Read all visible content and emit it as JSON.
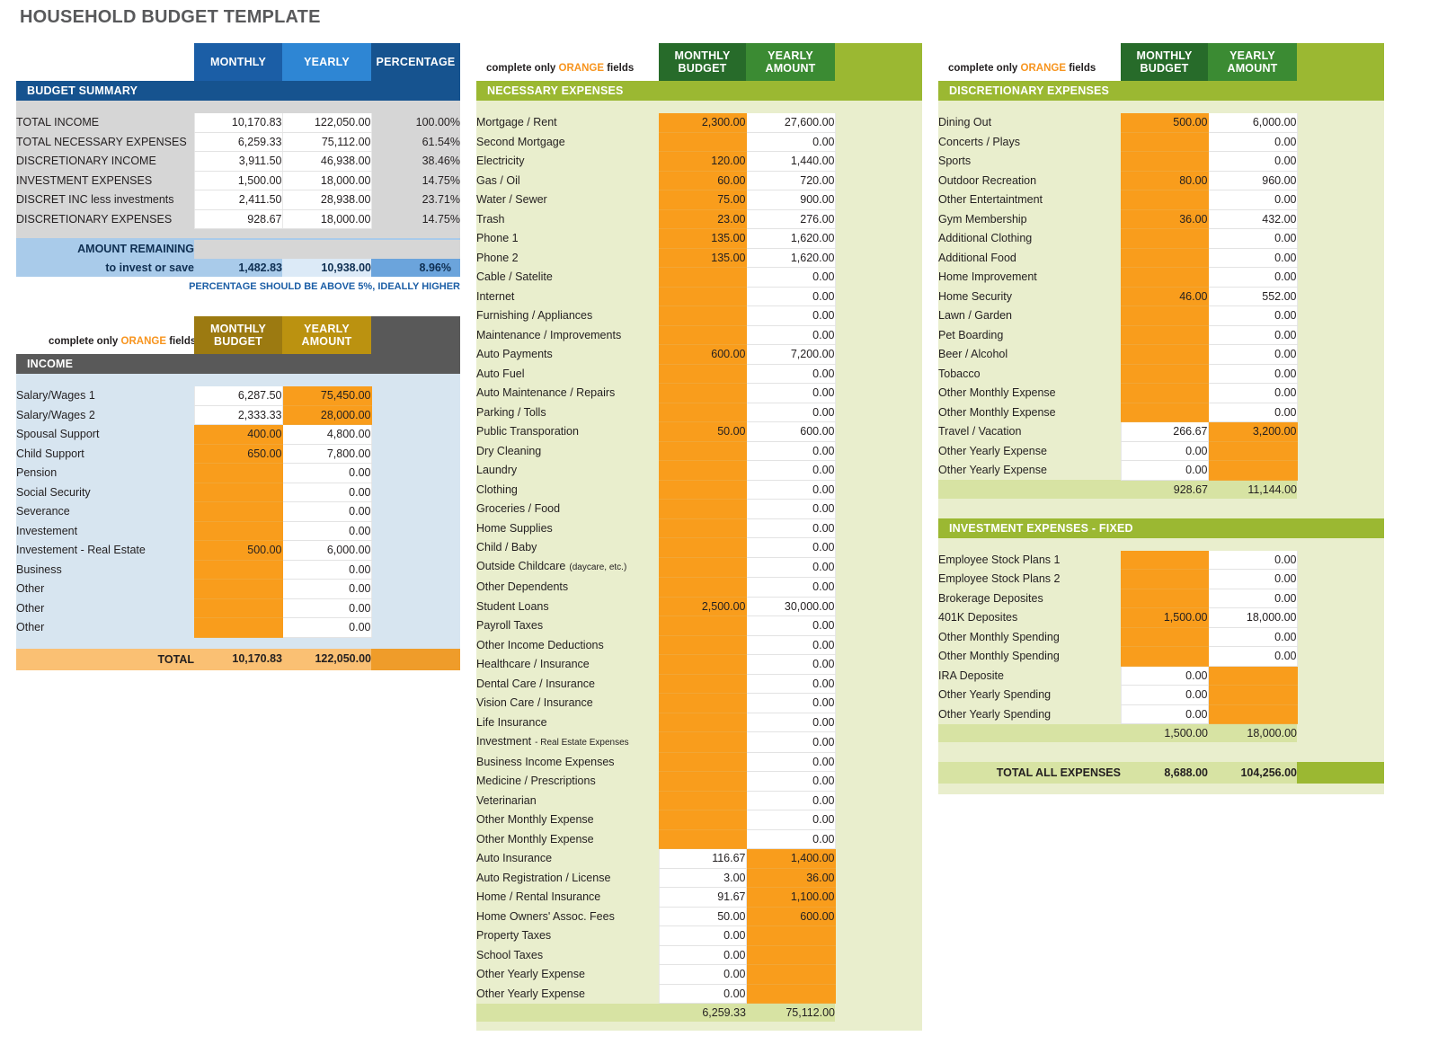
{
  "page_title": "HOUSEHOLD BUDGET TEMPLATE",
  "colors": {
    "orange": "#f99d1c",
    "blue_dark": "#16538f",
    "blue_mid": "#1b5ea6",
    "blue_light": "#2e86d4",
    "green_dark": "#276b2a",
    "green_mid": "#3b8b33",
    "green_light": "#9bb832",
    "gold": "#9c7a11",
    "grey": "#595959"
  },
  "summary": {
    "headers": [
      "MONTHLY",
      "YEARLY",
      "PERCENTAGE"
    ],
    "section_title": "BUDGET SUMMARY",
    "rows": [
      {
        "label": "TOTAL INCOME",
        "monthly": "10,170.83",
        "yearly": "122,050.00",
        "percentage": "100.00%"
      },
      {
        "label": "TOTAL NECESSARY EXPENSES",
        "monthly": "6,259.33",
        "yearly": "75,112.00",
        "percentage": "61.54%"
      },
      {
        "label": "DISCRETIONARY INCOME",
        "monthly": "3,911.50",
        "yearly": "46,938.00",
        "percentage": "38.46%"
      },
      {
        "label": "INVESTMENT EXPENSES",
        "monthly": "1,500.00",
        "yearly": "18,000.00",
        "percentage": "14.75%"
      },
      {
        "label": "DISCRET INC less investments",
        "monthly": "2,411.50",
        "yearly": "28,938.00",
        "percentage": "23.71%"
      },
      {
        "label": "DISCRETIONARY EXPENSES",
        "monthly": "928.67",
        "yearly": "18,000.00",
        "percentage": "14.75%"
      }
    ],
    "remaining": {
      "line1": "AMOUNT REMAINING",
      "line2": "to invest or save",
      "monthly": "1,482.83",
      "yearly": "10,938.00",
      "percentage": "8.96%"
    },
    "note": "PERCENTAGE SHOULD BE ABOVE 5%, IDEALLY HIGHER"
  },
  "complete_only": {
    "pre": "complete only ",
    "orange": "ORANGE",
    "post": " fields"
  },
  "income": {
    "headers": [
      "MONTHLY\nBUDGET",
      "YEARLY\nAMOUNT"
    ],
    "header_monthly_l1": "MONTHLY",
    "header_monthly_l2": "BUDGET",
    "header_yearly_l1": "YEARLY",
    "header_yearly_l2": "AMOUNT",
    "section_title": "INCOME",
    "rows": [
      {
        "label": "Salary/Wages 1",
        "monthly": "6,287.50",
        "yearly": "75,450.00",
        "monthly_orange": false,
        "yearly_orange": true
      },
      {
        "label": "Salary/Wages 2",
        "monthly": "2,333.33",
        "yearly": "28,000.00",
        "monthly_orange": false,
        "yearly_orange": true
      },
      {
        "label": "Spousal Support",
        "monthly": "400.00",
        "yearly": "4,800.00",
        "monthly_orange": true,
        "yearly_orange": false
      },
      {
        "label": "Child Support",
        "monthly": "650.00",
        "yearly": "7,800.00",
        "monthly_orange": true,
        "yearly_orange": false
      },
      {
        "label": "Pension",
        "monthly": "",
        "yearly": "0.00",
        "monthly_orange": true,
        "yearly_orange": false
      },
      {
        "label": "Social Security",
        "monthly": "",
        "yearly": "0.00",
        "monthly_orange": true,
        "yearly_orange": false
      },
      {
        "label": "Severance",
        "monthly": "",
        "yearly": "0.00",
        "monthly_orange": true,
        "yearly_orange": false
      },
      {
        "label": "Investement",
        "monthly": "",
        "yearly": "0.00",
        "monthly_orange": true,
        "yearly_orange": false
      },
      {
        "label": "Investement - Real Estate",
        "monthly": "500.00",
        "yearly": "6,000.00",
        "monthly_orange": true,
        "yearly_orange": false
      },
      {
        "label": "Business",
        "monthly": "",
        "yearly": "0.00",
        "monthly_orange": true,
        "yearly_orange": false
      },
      {
        "label": "Other",
        "monthly": "",
        "yearly": "0.00",
        "monthly_orange": true,
        "yearly_orange": false
      },
      {
        "label": "Other",
        "monthly": "",
        "yearly": "0.00",
        "monthly_orange": true,
        "yearly_orange": false
      },
      {
        "label": "Other",
        "monthly": "",
        "yearly": "0.00",
        "monthly_orange": true,
        "yearly_orange": false
      }
    ],
    "total": {
      "label": "TOTAL",
      "monthly": "10,170.83",
      "yearly": "122,050.00"
    }
  },
  "necessary": {
    "header_monthly_l1": "MONTHLY",
    "header_monthly_l2": "BUDGET",
    "header_yearly_l1": "YEARLY",
    "header_yearly_l2": "AMOUNT",
    "section_title": "NECESSARY EXPENSES",
    "rows": [
      {
        "label": "Mortgage / Rent",
        "monthly": "2,300.00",
        "yearly": "27,600.00",
        "monthly_orange": true,
        "yearly_orange": false
      },
      {
        "label": "Second Mortgage",
        "monthly": "",
        "yearly": "0.00",
        "monthly_orange": true,
        "yearly_orange": false
      },
      {
        "label": "Electricity",
        "monthly": "120.00",
        "yearly": "1,440.00",
        "monthly_orange": true,
        "yearly_orange": false
      },
      {
        "label": "Gas / Oil",
        "monthly": "60.00",
        "yearly": "720.00",
        "monthly_orange": true,
        "yearly_orange": false
      },
      {
        "label": "Water / Sewer",
        "monthly": "75.00",
        "yearly": "900.00",
        "monthly_orange": true,
        "yearly_orange": false
      },
      {
        "label": "Trash",
        "monthly": "23.00",
        "yearly": "276.00",
        "monthly_orange": true,
        "yearly_orange": false
      },
      {
        "label": "Phone 1",
        "monthly": "135.00",
        "yearly": "1,620.00",
        "monthly_orange": true,
        "yearly_orange": false
      },
      {
        "label": "Phone 2",
        "monthly": "135.00",
        "yearly": "1,620.00",
        "monthly_orange": true,
        "yearly_orange": false
      },
      {
        "label": "Cable / Satelite",
        "monthly": "",
        "yearly": "0.00",
        "monthly_orange": true,
        "yearly_orange": false
      },
      {
        "label": "Internet",
        "monthly": "",
        "yearly": "0.00",
        "monthly_orange": true,
        "yearly_orange": false
      },
      {
        "label": "Furnishing / Appliances",
        "monthly": "",
        "yearly": "0.00",
        "monthly_orange": true,
        "yearly_orange": false
      },
      {
        "label": "Maintenance / Improvements",
        "monthly": "",
        "yearly": "0.00",
        "monthly_orange": true,
        "yearly_orange": false
      },
      {
        "label": "Auto Payments",
        "monthly": "600.00",
        "yearly": "7,200.00",
        "monthly_orange": true,
        "yearly_orange": false
      },
      {
        "label": "Auto Fuel",
        "monthly": "",
        "yearly": "0.00",
        "monthly_orange": true,
        "yearly_orange": false
      },
      {
        "label": "Auto Maintenance / Repairs",
        "monthly": "",
        "yearly": "0.00",
        "monthly_orange": true,
        "yearly_orange": false
      },
      {
        "label": "Parking / Tolls",
        "monthly": "",
        "yearly": "0.00",
        "monthly_orange": true,
        "yearly_orange": false
      },
      {
        "label": "Public Transporation",
        "monthly": "50.00",
        "yearly": "600.00",
        "monthly_orange": true,
        "yearly_orange": false
      },
      {
        "label": "Dry Cleaning",
        "monthly": "",
        "yearly": "0.00",
        "monthly_orange": true,
        "yearly_orange": false
      },
      {
        "label": "Laundry",
        "monthly": "",
        "yearly": "0.00",
        "monthly_orange": true,
        "yearly_orange": false
      },
      {
        "label": "Clothing",
        "monthly": "",
        "yearly": "0.00",
        "monthly_orange": true,
        "yearly_orange": false
      },
      {
        "label": "Groceries / Food",
        "monthly": "",
        "yearly": "0.00",
        "monthly_orange": true,
        "yearly_orange": false
      },
      {
        "label": "Home Supplies",
        "monthly": "",
        "yearly": "0.00",
        "monthly_orange": true,
        "yearly_orange": false
      },
      {
        "label": "Child / Baby",
        "monthly": "",
        "yearly": "0.00",
        "monthly_orange": true,
        "yearly_orange": false
      },
      {
        "label": "Outside Childcare",
        "sublabel": "(daycare, etc.)",
        "monthly": "",
        "yearly": "0.00",
        "monthly_orange": true,
        "yearly_orange": false
      },
      {
        "label": "Other Dependents",
        "monthly": "",
        "yearly": "0.00",
        "monthly_orange": true,
        "yearly_orange": false
      },
      {
        "label": "Student Loans",
        "monthly": "2,500.00",
        "yearly": "30,000.00",
        "monthly_orange": true,
        "yearly_orange": false
      },
      {
        "label": "Payroll Taxes",
        "monthly": "",
        "yearly": "0.00",
        "monthly_orange": true,
        "yearly_orange": false
      },
      {
        "label": "Other Income Deductions",
        "monthly": "",
        "yearly": "0.00",
        "monthly_orange": true,
        "yearly_orange": false
      },
      {
        "label": "Healthcare / Insurance",
        "monthly": "",
        "yearly": "0.00",
        "monthly_orange": true,
        "yearly_orange": false
      },
      {
        "label": "Dental Care / Insurance",
        "monthly": "",
        "yearly": "0.00",
        "monthly_orange": true,
        "yearly_orange": false
      },
      {
        "label": "Vision Care / Insurance",
        "monthly": "",
        "yearly": "0.00",
        "monthly_orange": true,
        "yearly_orange": false
      },
      {
        "label": "Life Insurance",
        "monthly": "",
        "yearly": "0.00",
        "monthly_orange": true,
        "yearly_orange": false
      },
      {
        "label": "Investment",
        "sublabel": "- Real Estate Expenses",
        "monthly": "",
        "yearly": "0.00",
        "monthly_orange": true,
        "yearly_orange": false
      },
      {
        "label": "Business Income Expenses",
        "monthly": "",
        "yearly": "0.00",
        "monthly_orange": true,
        "yearly_orange": false
      },
      {
        "label": "Medicine / Prescriptions",
        "monthly": "",
        "yearly": "0.00",
        "monthly_orange": true,
        "yearly_orange": false
      },
      {
        "label": "Veterinarian",
        "monthly": "",
        "yearly": "0.00",
        "monthly_orange": true,
        "yearly_orange": false
      },
      {
        "label": "Other Monthly Expense",
        "monthly": "",
        "yearly": "0.00",
        "monthly_orange": true,
        "yearly_orange": false
      },
      {
        "label": "Other Monthly Expense",
        "monthly": "",
        "yearly": "0.00",
        "monthly_orange": true,
        "yearly_orange": false
      },
      {
        "label": "Auto Insurance",
        "monthly": "116.67",
        "yearly": "1,400.00",
        "monthly_orange": false,
        "yearly_orange": true
      },
      {
        "label": "Auto Registration / License",
        "monthly": "3.00",
        "yearly": "36.00",
        "monthly_orange": false,
        "yearly_orange": true
      },
      {
        "label": "Home / Rental Insurance",
        "monthly": "91.67",
        "yearly": "1,100.00",
        "monthly_orange": false,
        "yearly_orange": true
      },
      {
        "label": "Home Owners' Assoc. Fees",
        "monthly": "50.00",
        "yearly": "600.00",
        "monthly_orange": false,
        "yearly_orange": true
      },
      {
        "label": "Property Taxes",
        "monthly": "0.00",
        "yearly": "",
        "monthly_orange": false,
        "yearly_orange": true
      },
      {
        "label": "School Taxes",
        "monthly": "0.00",
        "yearly": "",
        "monthly_orange": false,
        "yearly_orange": true
      },
      {
        "label": "Other Yearly Expense",
        "monthly": "0.00",
        "yearly": "",
        "monthly_orange": false,
        "yearly_orange": true
      },
      {
        "label": "Other Yearly Expense",
        "monthly": "0.00",
        "yearly": "",
        "monthly_orange": false,
        "yearly_orange": true
      }
    ],
    "total": {
      "monthly": "6,259.33",
      "yearly": "75,112.00"
    }
  },
  "discretionary": {
    "header_monthly_l1": "MONTHLY",
    "header_monthly_l2": "BUDGET",
    "header_yearly_l1": "YEARLY",
    "header_yearly_l2": "AMOUNT",
    "section_title": "DISCRETIONARY EXPENSES",
    "rows": [
      {
        "label": "Dining Out",
        "monthly": "500.00",
        "yearly": "6,000.00",
        "monthly_orange": true,
        "yearly_orange": false
      },
      {
        "label": "Concerts / Plays",
        "monthly": "",
        "yearly": "0.00",
        "monthly_orange": true,
        "yearly_orange": false
      },
      {
        "label": "Sports",
        "monthly": "",
        "yearly": "0.00",
        "monthly_orange": true,
        "yearly_orange": false
      },
      {
        "label": "Outdoor Recreation",
        "monthly": "80.00",
        "yearly": "960.00",
        "monthly_orange": true,
        "yearly_orange": false
      },
      {
        "label": "Other Entertaintment",
        "monthly": "",
        "yearly": "0.00",
        "monthly_orange": true,
        "yearly_orange": false
      },
      {
        "label": "Gym Membership",
        "monthly": "36.00",
        "yearly": "432.00",
        "monthly_orange": true,
        "yearly_orange": false
      },
      {
        "label": "Additional Clothing",
        "monthly": "",
        "yearly": "0.00",
        "monthly_orange": true,
        "yearly_orange": false
      },
      {
        "label": "Additional Food",
        "monthly": "",
        "yearly": "0.00",
        "monthly_orange": true,
        "yearly_orange": false
      },
      {
        "label": "Home Improvement",
        "monthly": "",
        "yearly": "0.00",
        "monthly_orange": true,
        "yearly_orange": false
      },
      {
        "label": "Home Security",
        "monthly": "46.00",
        "yearly": "552.00",
        "monthly_orange": true,
        "yearly_orange": false
      },
      {
        "label": "Lawn / Garden",
        "monthly": "",
        "yearly": "0.00",
        "monthly_orange": true,
        "yearly_orange": false
      },
      {
        "label": "Pet Boarding",
        "monthly": "",
        "yearly": "0.00",
        "monthly_orange": true,
        "yearly_orange": false
      },
      {
        "label": "Beer / Alcohol",
        "monthly": "",
        "yearly": "0.00",
        "monthly_orange": true,
        "yearly_orange": false
      },
      {
        "label": "Tobacco",
        "monthly": "",
        "yearly": "0.00",
        "monthly_orange": true,
        "yearly_orange": false
      },
      {
        "label": "Other Monthly Expense",
        "monthly": "",
        "yearly": "0.00",
        "monthly_orange": true,
        "yearly_orange": false
      },
      {
        "label": "Other Monthly Expense",
        "monthly": "",
        "yearly": "0.00",
        "monthly_orange": true,
        "yearly_orange": false
      },
      {
        "label": "Travel / Vacation",
        "monthly": "266.67",
        "yearly": "3,200.00",
        "monthly_orange": false,
        "yearly_orange": true
      },
      {
        "label": "Other Yearly Expense",
        "monthly": "0.00",
        "yearly": "",
        "monthly_orange": false,
        "yearly_orange": true
      },
      {
        "label": "Other Yearly Expense",
        "monthly": "0.00",
        "yearly": "",
        "monthly_orange": false,
        "yearly_orange": true
      }
    ],
    "total": {
      "monthly": "928.67",
      "yearly": "11,144.00"
    }
  },
  "investment": {
    "section_title": "INVESTMENT EXPENSES - FIXED",
    "rows": [
      {
        "label": "Employee Stock Plans 1",
        "monthly": "",
        "yearly": "0.00",
        "monthly_orange": true,
        "yearly_orange": false
      },
      {
        "label": "Employee Stock Plans 2",
        "monthly": "",
        "yearly": "0.00",
        "monthly_orange": true,
        "yearly_orange": false
      },
      {
        "label": "Brokerage Deposites",
        "monthly": "",
        "yearly": "0.00",
        "monthly_orange": true,
        "yearly_orange": false
      },
      {
        "label": "401K Deposites",
        "monthly": "1,500.00",
        "yearly": "18,000.00",
        "monthly_orange": true,
        "yearly_orange": false
      },
      {
        "label": "Other Monthly Spending",
        "monthly": "",
        "yearly": "0.00",
        "monthly_orange": true,
        "yearly_orange": false
      },
      {
        "label": "Other Monthly Spending",
        "monthly": "",
        "yearly": "0.00",
        "monthly_orange": true,
        "yearly_orange": false
      },
      {
        "label": "IRA Deposite",
        "monthly": "0.00",
        "yearly": "",
        "monthly_orange": false,
        "yearly_orange": true
      },
      {
        "label": "Other Yearly Spending",
        "monthly": "0.00",
        "yearly": "",
        "monthly_orange": false,
        "yearly_orange": true
      },
      {
        "label": "Other Yearly Spending",
        "monthly": "0.00",
        "yearly": "",
        "monthly_orange": false,
        "yearly_orange": true
      }
    ],
    "total": {
      "monthly": "1,500.00",
      "yearly": "18,000.00"
    },
    "grand_total": {
      "label": "TOTAL ALL EXPENSES",
      "monthly": "8,688.00",
      "yearly": "104,256.00"
    }
  }
}
